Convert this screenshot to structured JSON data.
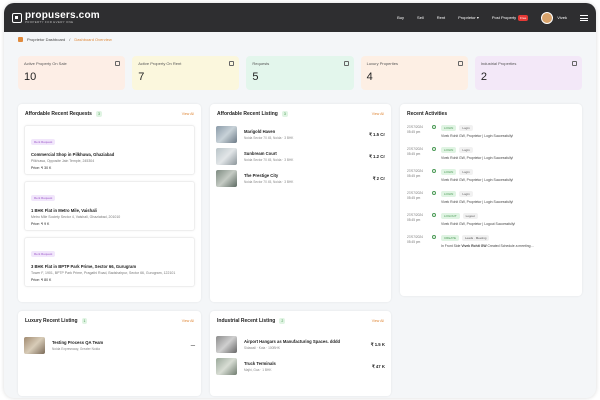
{
  "brand": {
    "name": "propusers.com",
    "tagline": "PROPERTY FOR EVERY ONE"
  },
  "nav": {
    "buy": "Buy",
    "sell": "Sell",
    "rent": "Rent",
    "proprietor": "Proprietor",
    "post_property": "Post Property",
    "post_badge": "Free",
    "user": "Vivek"
  },
  "breadcrumb": {
    "home": "Proprietor Dashboard",
    "active": "Dashboard Overview"
  },
  "stats": [
    {
      "label": "Active Property On Sale",
      "value": "10",
      "bg": "#fdeee6"
    },
    {
      "label": "Active Property On Rent",
      "value": "7",
      "bg": "#fbf7dd"
    },
    {
      "label": "Requests",
      "value": "5",
      "bg": "#e3f6ec"
    },
    {
      "label": "Luxury Properties",
      "value": "4",
      "bg": "#fdefe4"
    },
    {
      "label": "Industrial Properties",
      "value": "2",
      "bg": "#f3e8f8"
    }
  ],
  "requests": {
    "title": "Affordable Recent Requests",
    "count": "3",
    "view_all": "View All",
    "items": [
      {
        "tag": "Rent Request",
        "title": "Commercial Shop in Pilkhuwa, Ghaziabad",
        "address": "Pilkhuwa, Opposite Jain Temple, 245304",
        "price": "Price: ₹ 30 K"
      },
      {
        "tag": "Rent Request",
        "title": "1 BHK Flat in Metro Mile, Vaishali",
        "address": "Metro Mile Society Sector 4, Vaishali, Ghaziabad, 201010",
        "price": "Price: ₹ 9 K"
      },
      {
        "tag": "Rent Request",
        "title": "3 BHK Flat in BPTP Park Prime, Sector 66, Gurugram",
        "address": "Tower F, 1901, BPTP Park Prime, Pragathi Road, Badshahpur, Sector 66, Gurugram, 122101",
        "price": "Price: ₹ 80 K"
      }
    ]
  },
  "listing": {
    "title": "Affordable Recent Listing",
    "count": "3",
    "view_all": "View All",
    "items": [
      {
        "title": "Marigold Haven",
        "address": "Noida Sector 70 45, Noida · 3 BHK",
        "price": "₹ 1.5 Cr"
      },
      {
        "title": "Sunbream Court",
        "address": "Noida Sector 70 45, Noida · 3 BHK",
        "price": "₹ 1.2 Cr"
      },
      {
        "title": "The Prestige City",
        "address": "Noida Sector 70 45, Noida · 3 BHK",
        "price": "₹ 2 Cr"
      }
    ]
  },
  "activities": {
    "title": "Recent Activities",
    "items": [
      {
        "date": "27/07/2024",
        "time": "05:45 pm",
        "tag": "LOGIN",
        "kind": "Login",
        "msg": "Vivek Rohit GW, Proprietor | Login Successfully!"
      },
      {
        "date": "27/07/2024",
        "time": "05:45 pm",
        "tag": "LOGIN",
        "kind": "Login",
        "msg": "Vivek Rohit GW, Proprietor | Login Successfully!"
      },
      {
        "date": "27/07/2024",
        "time": "05:45 pm",
        "tag": "LOGIN",
        "kind": "Login",
        "msg": "Vivek Rohit GW, Proprietor | Login Successfully!"
      },
      {
        "date": "27/07/2024",
        "time": "05:45 pm",
        "tag": "LOGIN",
        "kind": "Login",
        "msg": "Vivek Rohit GW, Proprietor | Login Successfully!"
      },
      {
        "date": "27/07/2024",
        "time": "05:45 pm",
        "tag": "LOGOUT",
        "kind": "Logout",
        "msg": "Vivek Rohit GW, Proprietor | Logout Successfully!"
      },
      {
        "date": "27/07/2024",
        "time": "05:45 pm",
        "tag": "CREATE",
        "kind": "Leads · Meeting",
        "msg": "In Front Side <b>Vivek Rohit GW</b> Created Schedule a meeting…"
      }
    ]
  },
  "luxury": {
    "title": "Luxury Recent Listing",
    "count": "1",
    "view_all": "View All",
    "items": [
      {
        "title": "Testing Process QA Team",
        "address": "Noida Expressway, Greater Noida",
        "price": "—"
      }
    ]
  },
  "industrial": {
    "title": "Industrial Recent Listing",
    "count": "2",
    "view_all": "View All",
    "items": [
      {
        "title": "Airport Hangars as Manufacturing Spaces. dddd",
        "address": "Sidawali · Kota · 100BHK",
        "price": "₹ 1.5 K"
      },
      {
        "title": "Truck Terminals",
        "address": "Majhi, Goa · 1 BHK",
        "price": "₹ 47 K"
      }
    ]
  }
}
